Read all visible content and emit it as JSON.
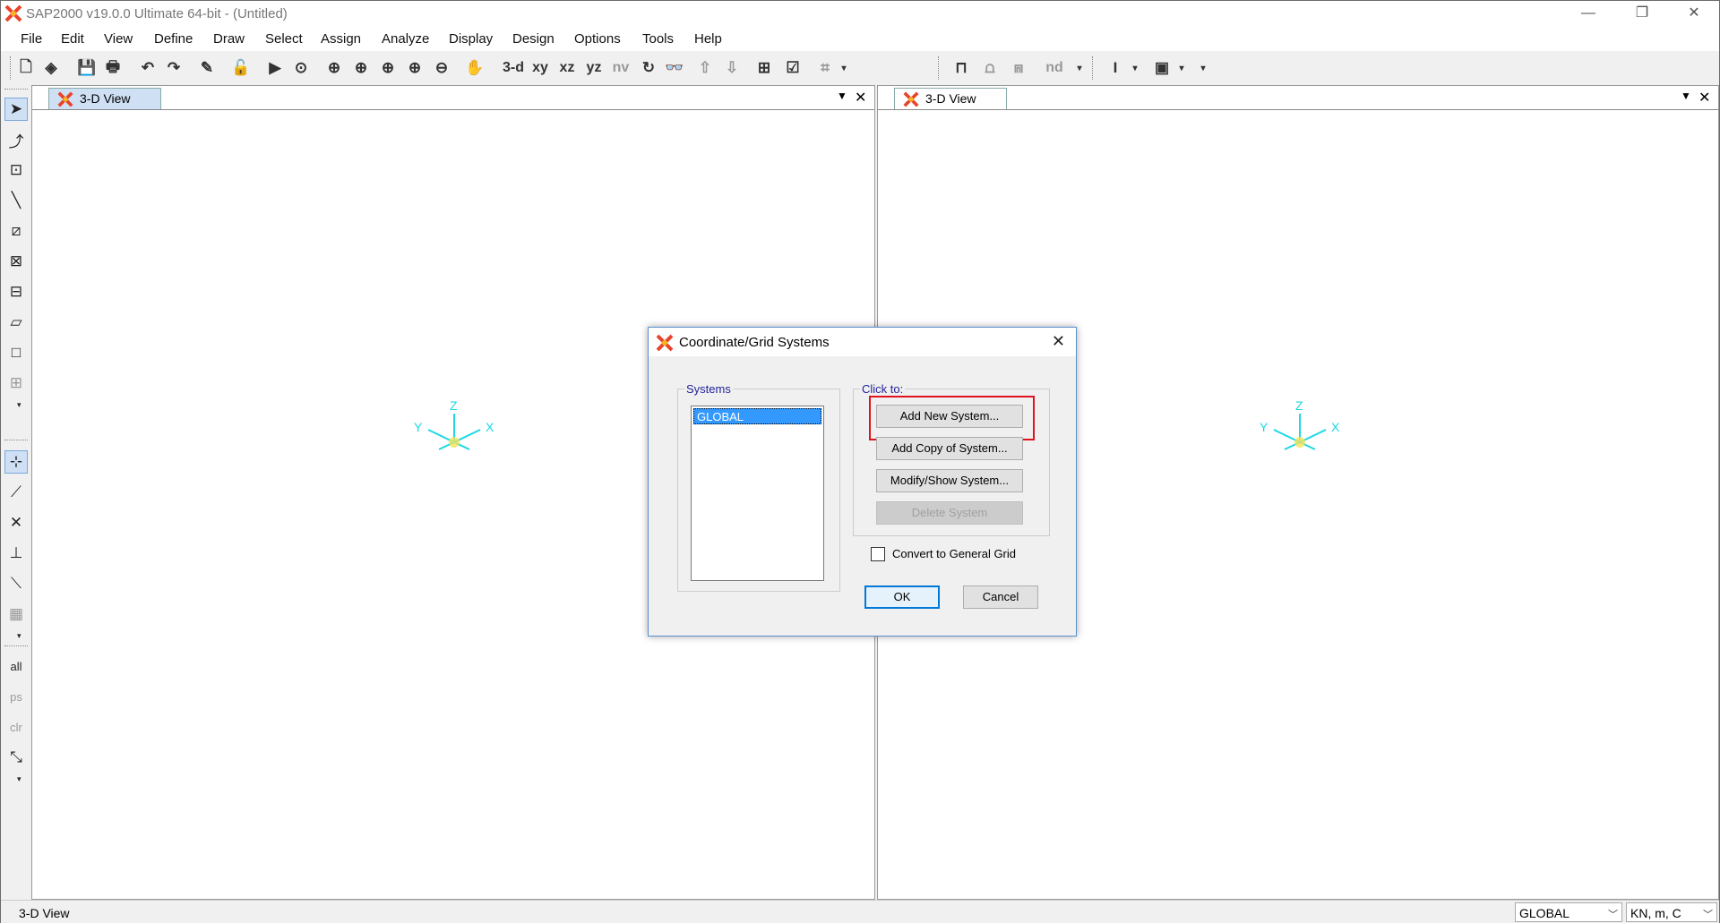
{
  "app": {
    "title": "SAP2000 v19.0.0 Ultimate 64-bit - (Untitled)",
    "window_controls": {
      "minimize": "—",
      "restore": "❐",
      "close": "✕"
    }
  },
  "menu": [
    "File",
    "Edit",
    "View",
    "Define",
    "Draw",
    "Select",
    "Assign",
    "Analyze",
    "Display",
    "Design",
    "Options",
    "Tools",
    "Help"
  ],
  "toolbar": {
    "text_buttons": [
      "3-d",
      "xy",
      "xz",
      "yz",
      "nv"
    ],
    "nd_label": "nd"
  },
  "panes": [
    {
      "tab": "3-D View",
      "axes": {
        "z": "Z",
        "y": "Y",
        "x": "X"
      }
    },
    {
      "tab": "3-D View",
      "axes": {
        "z": "Z",
        "y": "Y",
        "x": "X"
      }
    }
  ],
  "left_toolbar_text": {
    "all": "all",
    "ps": "ps",
    "clr": "clr"
  },
  "dialog": {
    "title": "Coordinate/Grid Systems",
    "systems_label": "Systems",
    "systems": [
      "GLOBAL"
    ],
    "click_to_label": "Click to:",
    "buttons": {
      "add_new": "Add New System...",
      "add_copy": "Add Copy of System...",
      "modify_show": "Modify/Show System...",
      "delete": "Delete System"
    },
    "convert_label": "Convert to General Grid",
    "ok": "OK",
    "cancel": "Cancel"
  },
  "status": {
    "view_name": "3-D View",
    "coord_system": "GLOBAL",
    "units": "KN, m, C"
  },
  "colors": {
    "axis": "#1ad8e6",
    "highlight": "#e0141e",
    "selection": "#3399ff",
    "accent": "#0078d7"
  }
}
